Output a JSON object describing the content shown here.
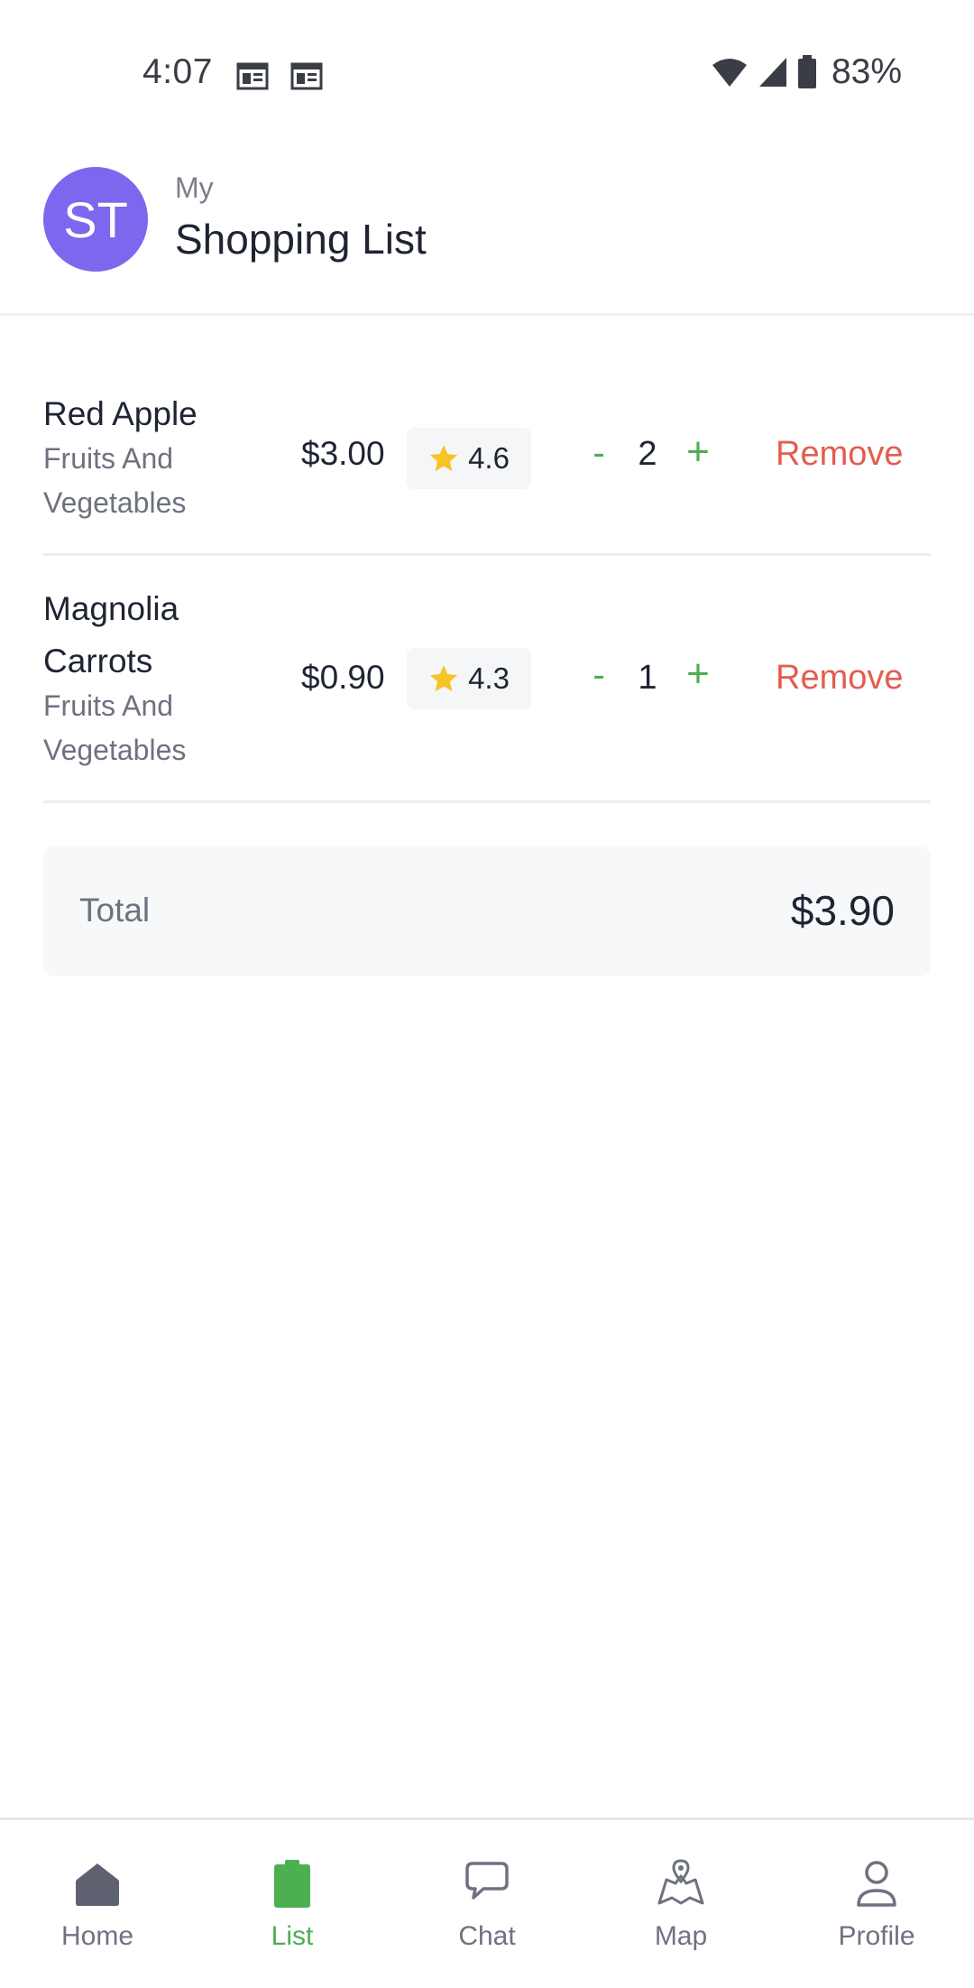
{
  "status_bar": {
    "time": "4:07",
    "battery": "83%"
  },
  "header": {
    "avatar_initials": "ST",
    "subtitle": "My",
    "title": "Shopping List"
  },
  "items": [
    {
      "name": "Red Apple",
      "category": "Fruits And Vegetables",
      "price": "$3.00",
      "rating": "4.6",
      "minus": "-",
      "quantity": "2",
      "plus": "+",
      "remove": "Remove"
    },
    {
      "name": "Magnolia Carrots",
      "category": "Fruits And Vegetables",
      "price": "$0.90",
      "rating": "4.3",
      "minus": "-",
      "quantity": "1",
      "plus": "+",
      "remove": "Remove"
    }
  ],
  "total": {
    "label": "Total",
    "value": "$3.90"
  },
  "nav": {
    "home": "Home",
    "list": "List",
    "chat": "Chat",
    "map": "Map",
    "profile": "Profile"
  },
  "colors": {
    "avatar": "#7b68ee",
    "accent_green": "#4caf50",
    "remove_red": "#e35d4f",
    "star": "#f7c325"
  }
}
